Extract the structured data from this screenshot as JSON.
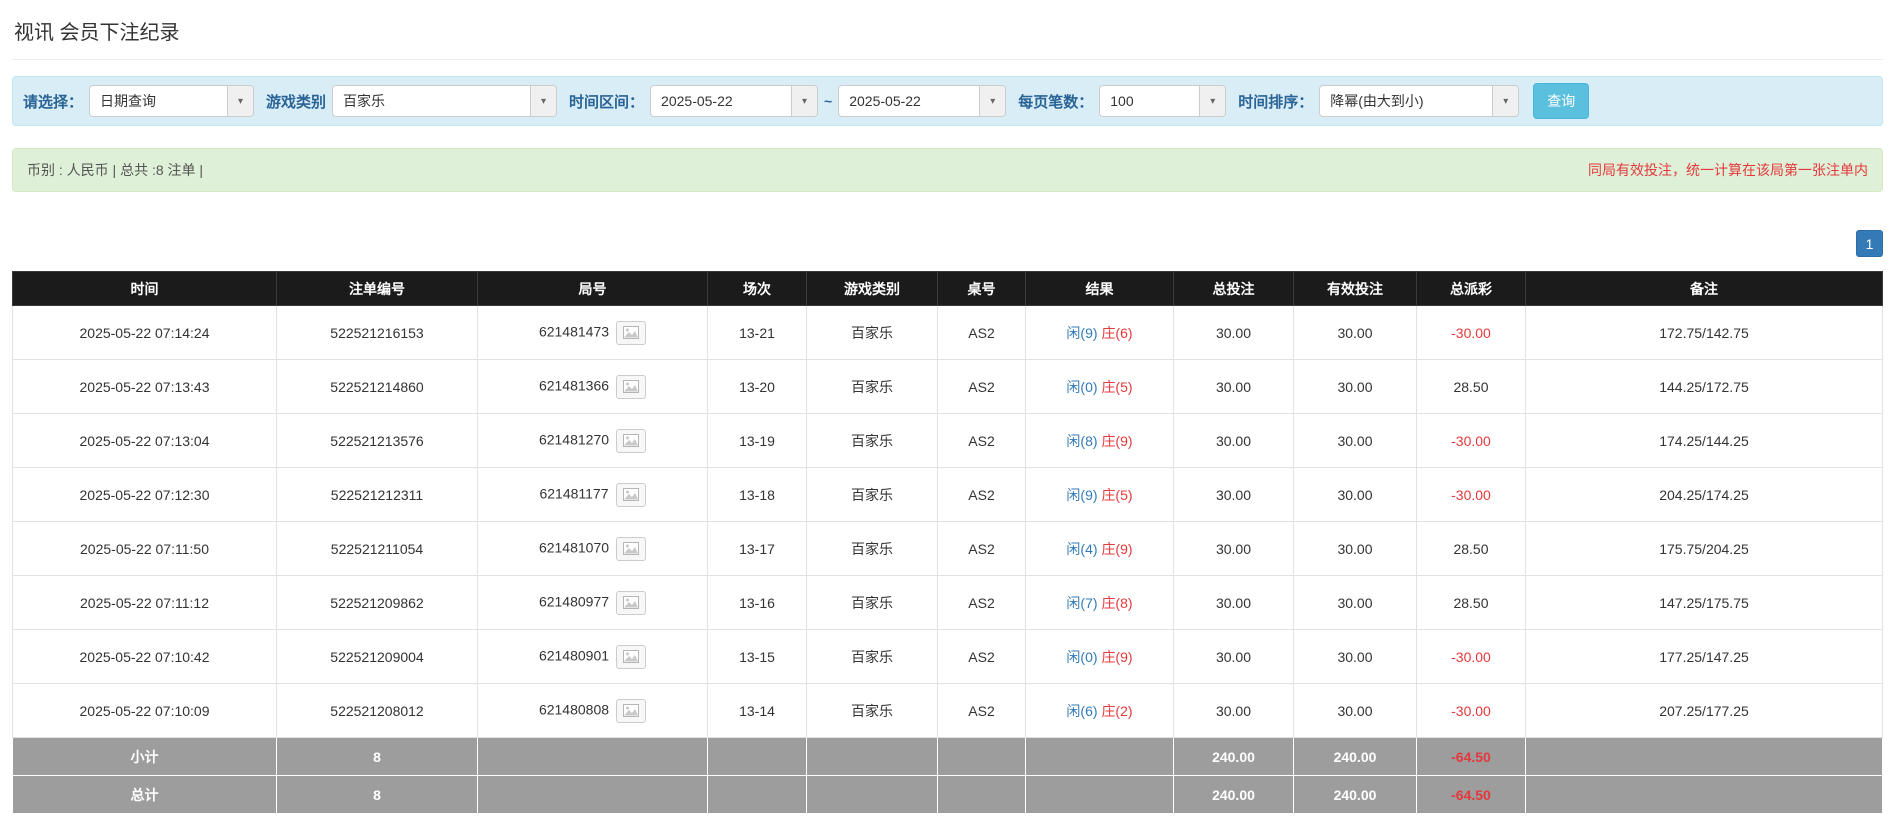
{
  "page": {
    "title": "视讯 会员下注纪录"
  },
  "filter_bar": {
    "query_type": {
      "label": "请选择：",
      "value": "日期查询"
    },
    "game_type": {
      "label": "游戏类别",
      "value": "百家乐"
    },
    "date_range": {
      "label": "时间区间：",
      "from": "2025-05-22",
      "separator": "~",
      "to": "2025-05-22"
    },
    "page_size": {
      "label": "每页笔数：",
      "value": "100"
    },
    "sort": {
      "label": "时间排序：",
      "value": "降幂(由大到小)"
    },
    "search_button": "查询"
  },
  "summary_bar": {
    "left_text": "币别 : 人民币 | 总共 :8 注单 |",
    "right_notice": "同局有效投注，统一计算在该局第一张注单内"
  },
  "pagination": {
    "current_page": "1"
  },
  "table": {
    "headers": [
      "时间",
      "注单编号",
      "局号",
      "场次",
      "游戏类别",
      "桌号",
      "结果",
      "总投注",
      "有效投注",
      "总派彩",
      "备注"
    ],
    "rows": [
      {
        "time": "2025-05-22 07:14:24",
        "bet_id": "522521216153",
        "round_id": "621481473",
        "session": "13-21",
        "game": "百家乐",
        "table_no": "AS2",
        "result_player": "闲(9)",
        "result_banker": "庄(6)",
        "total_bet": "30.00",
        "valid_bet": "30.00",
        "payout": "-30.00",
        "remark": "172.75/142.75"
      },
      {
        "time": "2025-05-22 07:13:43",
        "bet_id": "522521214860",
        "round_id": "621481366",
        "session": "13-20",
        "game": "百家乐",
        "table_no": "AS2",
        "result_player": "闲(0)",
        "result_banker": "庄(5)",
        "total_bet": "30.00",
        "valid_bet": "30.00",
        "payout": "28.50",
        "remark": "144.25/172.75"
      },
      {
        "time": "2025-05-22 07:13:04",
        "bet_id": "522521213576",
        "round_id": "621481270",
        "session": "13-19",
        "game": "百家乐",
        "table_no": "AS2",
        "result_player": "闲(8)",
        "result_banker": "庄(9)",
        "total_bet": "30.00",
        "valid_bet": "30.00",
        "payout": "-30.00",
        "remark": "174.25/144.25"
      },
      {
        "time": "2025-05-22 07:12:30",
        "bet_id": "522521212311",
        "round_id": "621481177",
        "session": "13-18",
        "game": "百家乐",
        "table_no": "AS2",
        "result_player": "闲(9)",
        "result_banker": "庄(5)",
        "total_bet": "30.00",
        "valid_bet": "30.00",
        "payout": "-30.00",
        "remark": "204.25/174.25"
      },
      {
        "time": "2025-05-22 07:11:50",
        "bet_id": "522521211054",
        "round_id": "621481070",
        "session": "13-17",
        "game": "百家乐",
        "table_no": "AS2",
        "result_player": "闲(4)",
        "result_banker": "庄(9)",
        "total_bet": "30.00",
        "valid_bet": "30.00",
        "payout": "28.50",
        "remark": "175.75/204.25"
      },
      {
        "time": "2025-05-22 07:11:12",
        "bet_id": "522521209862",
        "round_id": "621480977",
        "session": "13-16",
        "game": "百家乐",
        "table_no": "AS2",
        "result_player": "闲(7)",
        "result_banker": "庄(8)",
        "total_bet": "30.00",
        "valid_bet": "30.00",
        "payout": "28.50",
        "remark": "147.25/175.75"
      },
      {
        "time": "2025-05-22 07:10:42",
        "bet_id": "522521209004",
        "round_id": "621480901",
        "session": "13-15",
        "game": "百家乐",
        "table_no": "AS2",
        "result_player": "闲(0)",
        "result_banker": "庄(9)",
        "total_bet": "30.00",
        "valid_bet": "30.00",
        "payout": "-30.00",
        "remark": "177.25/147.25"
      },
      {
        "time": "2025-05-22 07:10:09",
        "bet_id": "522521208012",
        "round_id": "621480808",
        "session": "13-14",
        "game": "百家乐",
        "table_no": "AS2",
        "result_player": "闲(6)",
        "result_banker": "庄(2)",
        "total_bet": "30.00",
        "valid_bet": "30.00",
        "payout": "-30.00",
        "remark": "207.25/177.25"
      }
    ],
    "subtotal_row": {
      "label": "小计",
      "count": "8",
      "total_bet": "240.00",
      "valid_bet": "240.00",
      "payout": "-64.50"
    },
    "total_row": {
      "label": "总计",
      "count": "8",
      "total_bet": "240.00",
      "valid_bet": "240.00",
      "payout": "-64.50"
    }
  },
  "colors": {
    "player_blue": "#337ab7",
    "banker_red": "#e4393c",
    "negative_red": "#e4393c",
    "link_blue": "#337ab7",
    "header_bg": "#1b1b1b",
    "filter_bg": "#d9edf7",
    "filter_border": "#bce8f1",
    "filter_label": "#2a6496",
    "summary_bg": "#dff0d8",
    "summary_border": "#d6e9c6",
    "notice_red": "#e4393c",
    "footer_bg": "#9d9d9d",
    "search_btn_bg": "#5bc0de",
    "pagination_bg": "#337ab7"
  }
}
